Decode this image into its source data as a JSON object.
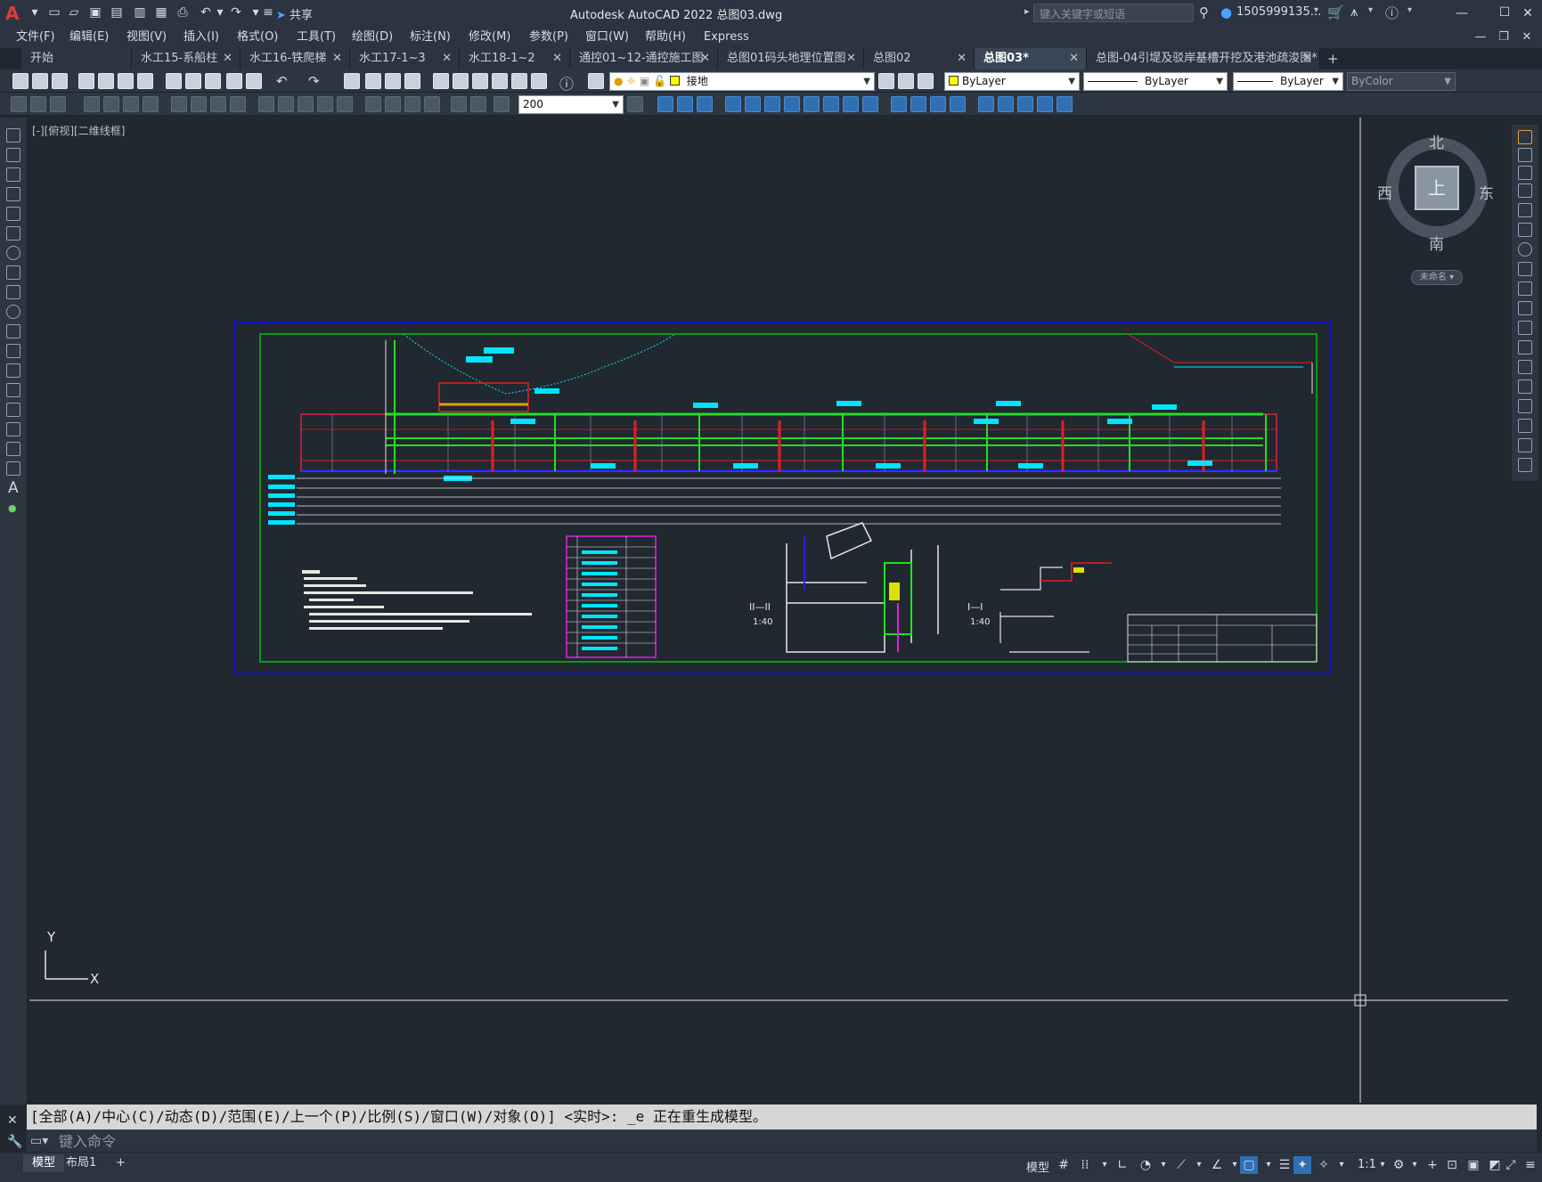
{
  "app": {
    "title": "Autodesk AutoCAD 2022    总图03.dwg",
    "share_label": "共享",
    "search_placeholder": "键入关键字或短语",
    "user": "1505999135...",
    "window_controls": [
      "—",
      "☐",
      "✕"
    ],
    "doc_controls": [
      "—",
      "❐",
      "✕"
    ]
  },
  "menu": [
    "文件(F)",
    "编辑(E)",
    "视图(V)",
    "插入(I)",
    "格式(O)",
    "工具(T)",
    "绘图(D)",
    "标注(N)",
    "修改(M)",
    "参数(P)",
    "窗口(W)",
    "帮助(H)",
    "Express"
  ],
  "tabs": [
    {
      "label": "开始",
      "closable": false,
      "active": false
    },
    {
      "label": "水工15-系船柱",
      "closable": true,
      "active": false
    },
    {
      "label": "水工16-铁爬梯",
      "closable": true,
      "active": false
    },
    {
      "label": "水工17-1~3",
      "closable": true,
      "active": false
    },
    {
      "label": "水工18-1~2",
      "closable": true,
      "active": false
    },
    {
      "label": "通控01~12-通控施工图",
      "closable": true,
      "active": false
    },
    {
      "label": "总图01码头地理位置图",
      "closable": true,
      "active": false
    },
    {
      "label": "总图02",
      "closable": true,
      "active": false
    },
    {
      "label": "总图03*",
      "closable": true,
      "active": true
    },
    {
      "label": "总图-04引堤及驳岸基槽开挖及港池疏浚图*",
      "closable": true,
      "active": false
    }
  ],
  "tab_add": "+",
  "toolbar": {
    "layer_current": "接地",
    "color": "ByLayer",
    "linetype": "ByLayer",
    "lineweight": "ByLayer",
    "plotstyle": "ByColor",
    "dimscale": "200",
    "layer_color": "#ffff00"
  },
  "viewport": {
    "label": "[-][俯视][二维线框]"
  },
  "viewcube": {
    "north": "北",
    "south": "南",
    "east": "东",
    "west": "西",
    "top": "上",
    "wcs": "未命名"
  },
  "ucs": {
    "x": "X",
    "y": "Y"
  },
  "command": {
    "history": "[全部(A)/中心(C)/动态(D)/范围(E)/上一个(P)/比例(S)/窗口(W)/对象(O)] <实时>: _e 正在重生成模型。",
    "placeholder": "键入命令"
  },
  "status": {
    "layout_tabs": [
      "模型",
      "布局1"
    ],
    "add": "+",
    "model_label": "模型",
    "scale": "1:1"
  },
  "drawing": {
    "section_labels": [
      "II—II",
      "1:40",
      "I—I",
      "1:40"
    ],
    "colors": {
      "frame_outer": "#1010d0",
      "frame_inner": "#00c000",
      "accent": "#00e5ff"
    }
  }
}
